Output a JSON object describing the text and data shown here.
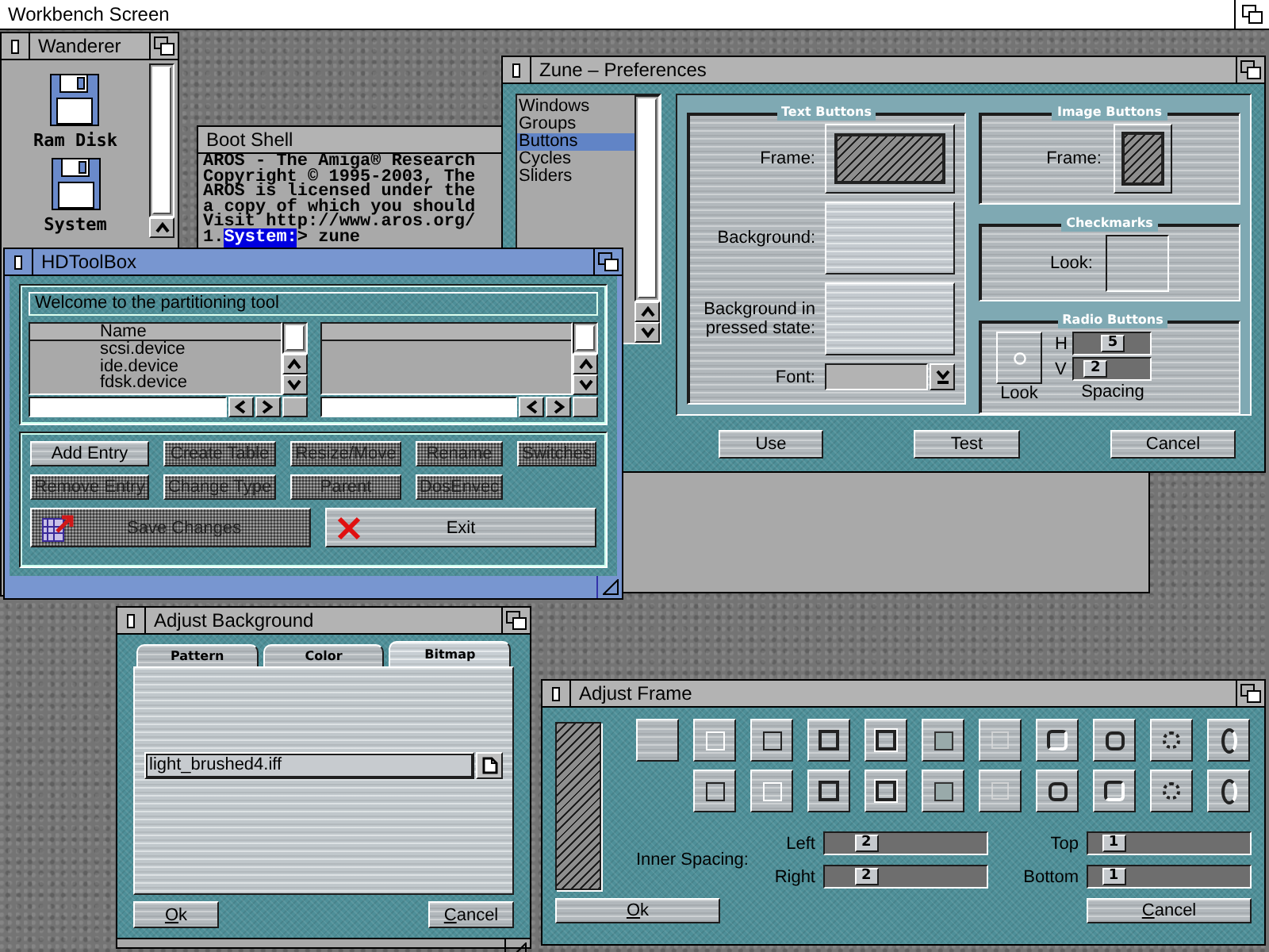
{
  "screen": {
    "title": "Workbench Screen"
  },
  "wanderer": {
    "title": "Wanderer",
    "active": false,
    "icons": [
      {
        "label": "Ram Disk"
      },
      {
        "label": "System"
      }
    ]
  },
  "boot_shell": {
    "title": "Boot Shell",
    "active": false,
    "lines": [
      {
        "kind": "output",
        "text": "AROS - The Amiga® Research"
      },
      {
        "kind": "output",
        "text": "Copyright © 1995-2003, The"
      },
      {
        "kind": "output",
        "text": "AROS is licensed under the"
      },
      {
        "kind": "output",
        "text": "a copy of which you should"
      },
      {
        "kind": "output",
        "text": "Visit http://www.aros.org/"
      },
      {
        "kind": "prompt",
        "number": "1.",
        "path": "System:",
        "text": "> zune"
      }
    ]
  },
  "zune_preferences": {
    "title": "Zune – Preferences",
    "active": false,
    "categories": [
      {
        "label": "Windows",
        "selected": false
      },
      {
        "label": "Groups",
        "selected": false
      },
      {
        "label": "Buttons",
        "selected": true
      },
      {
        "label": "Cycles",
        "selected": false
      },
      {
        "label": "Sliders",
        "selected": false
      }
    ],
    "text_buttons": {
      "title": "Text Buttons",
      "frame_label": "Frame:",
      "background_label": "Background:",
      "pressed_label": "Background in pressed state:",
      "font_label": "Font:"
    },
    "image_buttons": {
      "title": "Image Buttons",
      "frame_label": "Frame:"
    },
    "checkmarks": {
      "title": "Checkmarks",
      "look_label": "Look:"
    },
    "radio_buttons": {
      "title": "Radio Buttons",
      "look_label": "Look",
      "spacing_label": "Spacing",
      "sliders": [
        {
          "label": "H",
          "value": "5",
          "level": 0.55
        },
        {
          "label": "V",
          "value": "2",
          "level": 0.2
        }
      ]
    },
    "buttons": [
      "Use",
      "Test",
      "Cancel"
    ]
  },
  "hdtoolbox": {
    "title": "HDToolBox",
    "active": true,
    "message": "Welcome to the partitioning tool",
    "device_list": {
      "header": "Name",
      "rows": [
        "scsi.device",
        "ide.device",
        "fdsk.device"
      ]
    },
    "actions": [
      {
        "label": "Add Entry",
        "disabled": false
      },
      {
        "label": "Create Table",
        "disabled": true
      },
      {
        "label": "Resize/Move",
        "disabled": true
      },
      {
        "label": "Rename",
        "disabled": true
      },
      {
        "label": "Switches",
        "disabled": true
      },
      {
        "label": "Remove Entry",
        "disabled": true
      },
      {
        "label": "Change Type",
        "disabled": true
      },
      {
        "label": "Parent",
        "disabled": true
      },
      {
        "label": "DosEnvec",
        "disabled": true
      }
    ],
    "save": {
      "label": "Save Changes",
      "disabled": true
    },
    "exit": {
      "label": "Exit",
      "disabled": false
    }
  },
  "adjust_background": {
    "title": "Adjust Background",
    "active": false,
    "tabs": [
      {
        "label": "Pattern",
        "selected": false
      },
      {
        "label": "Color",
        "selected": false
      },
      {
        "label": "Bitmap",
        "selected": true
      }
    ],
    "file": {
      "value": "light_brushed4.iff"
    },
    "buttons": [
      "Ok",
      "Cancel"
    ]
  },
  "adjust_frame": {
    "title": "Adjust Frame",
    "active": false,
    "style_rows": [
      {
        "styles": [
          {
            "kind": "none"
          },
          {
            "kind": "thin-light"
          },
          {
            "kind": "thin-dark"
          },
          {
            "kind": "thick"
          },
          {
            "kind": "double"
          },
          {
            "kind": "flat"
          },
          {
            "kind": "ghost"
          },
          {
            "kind": "rounded-light"
          },
          {
            "kind": "rounded-dark"
          },
          {
            "kind": "round-dot"
          },
          {
            "kind": "oval"
          }
        ]
      },
      {
        "styles": [
          {
            "kind": "thin-dark"
          },
          {
            "kind": "thin-light"
          },
          {
            "kind": "thick"
          },
          {
            "kind": "double"
          },
          {
            "kind": "flat"
          },
          {
            "kind": "ghost"
          },
          {
            "kind": "rounded-dark"
          },
          {
            "kind": "rounded-light"
          },
          {
            "kind": "round-dot"
          },
          {
            "kind": "oval"
          }
        ]
      }
    ],
    "inner_spacing": {
      "label": "Inner Spacing:",
      "sliders": [
        {
          "label": "Left",
          "value": "2",
          "level": 0.22
        },
        {
          "label": "Top",
          "value": "1",
          "level": 0.1
        },
        {
          "label": "Right",
          "value": "2",
          "level": 0.22
        },
        {
          "label": "Bottom",
          "value": "1",
          "level": 0.1
        }
      ]
    },
    "buttons": [
      "Ok",
      "Cancel"
    ]
  }
}
